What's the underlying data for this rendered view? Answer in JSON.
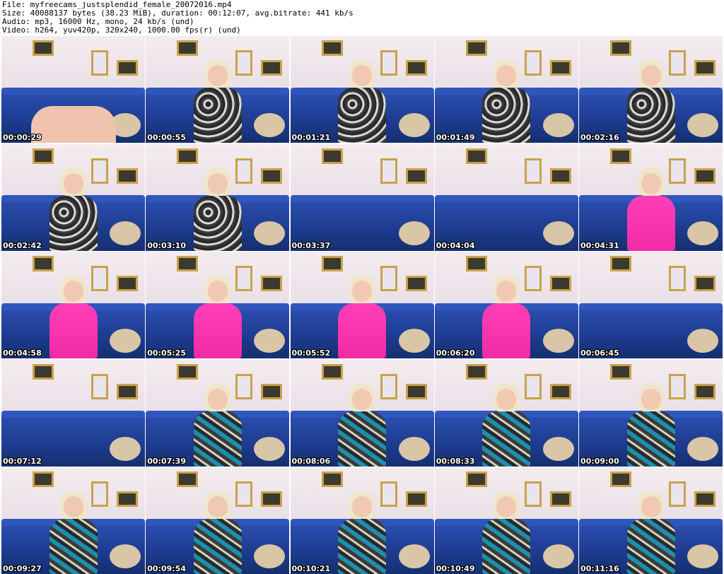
{
  "header": {
    "file": "File: myfreecams_justsplendid_female_20072016.mp4",
    "size": "Size: 40088137 bytes (38.23 MiB), duration: 00:12:07, avg.bitrate: 441 kb/s",
    "audio": "Audio: mp3, 16000 Hz, mono, 24 kb/s (und)",
    "video": "Video: h264, yuv420p, 320x240, 1000.00 fps(r) (und)"
  },
  "thumbnails": [
    {
      "timestamp": "00:00:29",
      "scene": "legs",
      "dress": "floral"
    },
    {
      "timestamp": "00:00:55",
      "scene": "person",
      "dress": "floral"
    },
    {
      "timestamp": "00:01:21",
      "scene": "person",
      "dress": "floral"
    },
    {
      "timestamp": "00:01:49",
      "scene": "person",
      "dress": "floral"
    },
    {
      "timestamp": "00:02:16",
      "scene": "person",
      "dress": "floral"
    },
    {
      "timestamp": "00:02:42",
      "scene": "person",
      "dress": "floral"
    },
    {
      "timestamp": "00:03:10",
      "scene": "person",
      "dress": "floral"
    },
    {
      "timestamp": "00:03:37",
      "scene": "empty",
      "dress": "none"
    },
    {
      "timestamp": "00:04:04",
      "scene": "empty",
      "dress": "none"
    },
    {
      "timestamp": "00:04:31",
      "scene": "person",
      "dress": "pink"
    },
    {
      "timestamp": "00:04:58",
      "scene": "person",
      "dress": "pink"
    },
    {
      "timestamp": "00:05:25",
      "scene": "person",
      "dress": "pink"
    },
    {
      "timestamp": "00:05:52",
      "scene": "person",
      "dress": "pink"
    },
    {
      "timestamp": "00:06:20",
      "scene": "person",
      "dress": "pink"
    },
    {
      "timestamp": "00:06:45",
      "scene": "empty",
      "dress": "none"
    },
    {
      "timestamp": "00:07:12",
      "scene": "empty",
      "dress": "none"
    },
    {
      "timestamp": "00:07:39",
      "scene": "person",
      "dress": "teal"
    },
    {
      "timestamp": "00:08:06",
      "scene": "person",
      "dress": "teal"
    },
    {
      "timestamp": "00:08:33",
      "scene": "person",
      "dress": "teal"
    },
    {
      "timestamp": "00:09:00",
      "scene": "person",
      "dress": "teal"
    },
    {
      "timestamp": "00:09:27",
      "scene": "person",
      "dress": "teal"
    },
    {
      "timestamp": "00:09:54",
      "scene": "person",
      "dress": "teal"
    },
    {
      "timestamp": "00:10:21",
      "scene": "person",
      "dress": "teal"
    },
    {
      "timestamp": "00:10:49",
      "scene": "person",
      "dress": "teal"
    },
    {
      "timestamp": "00:11:16",
      "scene": "person",
      "dress": "teal"
    }
  ]
}
